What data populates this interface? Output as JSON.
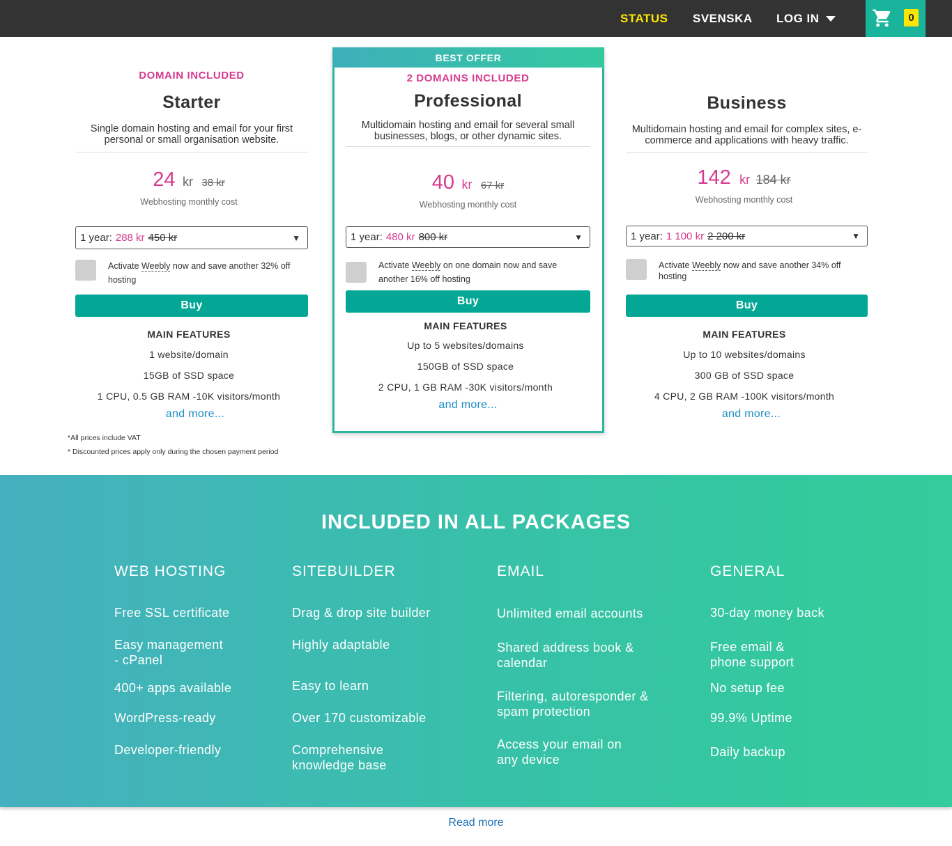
{
  "nav": {
    "status": "STATUS",
    "language": "SVENSKA",
    "login": "LOG IN",
    "cart_count": "0",
    "cart_icon": "shopping-cart-icon",
    "colors": {
      "bar": "#333333",
      "status": "#ffe600",
      "cart_bg": "#1ab39c"
    }
  },
  "plans": {
    "starter": {
      "tag": "DOMAIN INCLUDED",
      "name": "Starter",
      "desc": "Single domain hosting and email for your first personal or small organisation website.",
      "price": "24",
      "unit": "kr",
      "old_price": "38 kr",
      "caption": "Webhosting monthly cost",
      "select_prefix": "1 year:",
      "select_price": "288 kr",
      "select_old": "450 kr",
      "weebly_pre": "Activate ",
      "weebly_link": "Weebly",
      "weebly_post": " now and save another 32% off hosting",
      "buy": "Buy",
      "features_title": "MAIN FEATURES",
      "features": [
        "1 website/domain",
        "15GB of SSD space",
        "1 CPU, 0.5 GB RAM -10K visitors/month"
      ],
      "more": "and more..."
    },
    "professional": {
      "badge": "BEST OFFER",
      "tag": "2 DOMAINS INCLUDED",
      "name": "Professional",
      "desc": "Multidomain hosting and email for several small businesses, blogs, or other dynamic sites.",
      "price": "40",
      "unit": "kr",
      "old_price": "67 kr",
      "caption": "Webhosting monthly cost",
      "select_prefix": "1 year:",
      "select_price": "480 kr",
      "select_old": "800 kr",
      "weebly_pre": "Activate ",
      "weebly_link": "Weebly",
      "weebly_post": " on one domain now and save another 16% off hosting",
      "buy": "Buy",
      "features_title": "MAIN FEATURES",
      "features": [
        "Up to 5 websites/domains",
        "150GB of SSD space",
        "2 CPU, 1 GB RAM -30K visitors/month"
      ],
      "more": "and more..."
    },
    "business": {
      "tag": "",
      "name": "Business",
      "desc": "Multidomain hosting and email for complex sites, e-commerce and applications with heavy traffic.",
      "price": "142",
      "unit": "kr",
      "old_price": "184 kr",
      "caption": "Webhosting monthly cost",
      "select_prefix": "1 year:",
      "select_price": "1 100 kr",
      "select_old": "2 200 kr",
      "weebly_pre": "Activate ",
      "weebly_link": "Weebly",
      "weebly_post": " now and save another 34% off hosting",
      "buy": "Buy",
      "features_title": "MAIN FEATURES",
      "features": [
        "Up to 10 websites/domains",
        "300 GB of SSD space",
        "4 CPU, 2 GB RAM -100K visitors/month"
      ],
      "more": "and more..."
    }
  },
  "notes": [
    "*All prices include VAT",
    "* Discounted prices apply only during the chosen payment period"
  ],
  "included": {
    "title": "INCLUDED IN ALL PACKAGES",
    "columns": [
      {
        "title": "WEB HOSTING",
        "items": [
          "Free SSL certificate",
          "Easy management\n- cPanel",
          "400+ apps available",
          "WordPress-ready",
          "Developer-friendly"
        ]
      },
      {
        "title": "SITEBUILDER",
        "items": [
          "Drag & drop site builder",
          "Highly adaptable",
          "Easy to learn",
          "Over 170 customizable",
          "Comprehensive\nknowledge base"
        ]
      },
      {
        "title": "EMAIL",
        "items": [
          "Unlimited email accounts",
          "Shared address book &\ncalendar",
          "Filtering, autoresponder &\nspam protection",
          "Access your email on\nany device"
        ]
      },
      {
        "title": "GENERAL",
        "items": [
          "30-day money back",
          "Free email &\nphone support",
          "No setup fee",
          "99.9% Uptime",
          "Daily backup"
        ]
      }
    ]
  },
  "read_more": "Read more",
  "colors": {
    "accent_pink": "#d63a8f",
    "buy_green": "#04a796",
    "link_blue": "#1a8cc4"
  }
}
